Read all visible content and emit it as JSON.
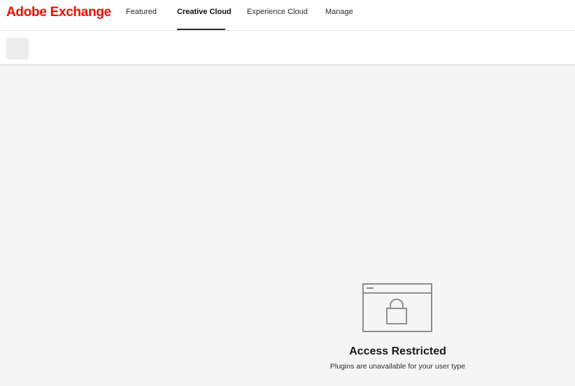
{
  "brand": {
    "name": "Adobe Exchange"
  },
  "nav": {
    "items": [
      {
        "label": "Featured",
        "active": false
      },
      {
        "label": "Creative Cloud",
        "active": true
      },
      {
        "label": "Experience Cloud",
        "active": false
      },
      {
        "label": "Manage",
        "active": false
      }
    ]
  },
  "colors": {
    "brand_red": "#eb1000",
    "page_background": "#f5f5f5",
    "illustration_stroke": "#8e8e8e"
  },
  "restricted": {
    "icon": "browser-lock-icon",
    "title": "Access Restricted",
    "message": "Plugins are unavailable for your user type"
  }
}
